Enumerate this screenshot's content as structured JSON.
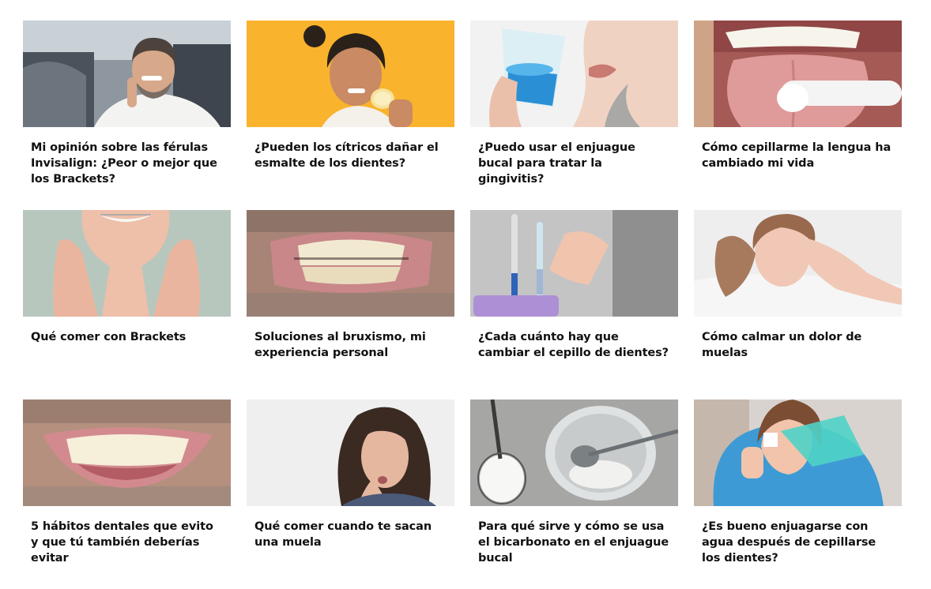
{
  "articles": [
    {
      "title": "Mi opinión sobre las férulas Invisalign: ¿Peor o mejor que los Brackets?",
      "image": "man-in-car-smiling-photo"
    },
    {
      "title": "¿Pueden los cítricos dañar el esmalte de los dientes?",
      "image": "woman-biting-lemon-photo"
    },
    {
      "title": "¿Puedo usar el enjuague bucal para tratar la gingivitis?",
      "image": "woman-drinking-mouthwash-photo"
    },
    {
      "title": "Cómo cepillarme la lengua ha cambiado mi vida",
      "image": "tongue-brushing-photo"
    },
    {
      "title": "Qué comer con Brackets",
      "image": "smile-with-braces-photo"
    },
    {
      "title": "Soluciones al bruxismo, mi experiencia personal",
      "image": "clenched-teeth-photo"
    },
    {
      "title": "¿Cada cuánto hay que cambiar el cepillo de dientes?",
      "image": "toothbrushes-in-cup-photo"
    },
    {
      "title": "Cómo calmar un dolor de muelas",
      "image": "woman-with-toothache-in-bed-photo"
    },
    {
      "title": "5 hábitos dentales que evito y que tú también deberías evitar",
      "image": "smiling-teeth-closeup-photo"
    },
    {
      "title": "Qué comer cuando te sacan una muela",
      "image": "woman-holding-jaw-photo"
    },
    {
      "title": "Para qué sirve y cómo se usa el bicarbonato en el enjuague bucal",
      "image": "baking-soda-glass-photo"
    },
    {
      "title": "¿Es bueno enjuagarse con agua después de cepillarse los dientes?",
      "image": "woman-pouring-mouthwash-photo"
    }
  ]
}
